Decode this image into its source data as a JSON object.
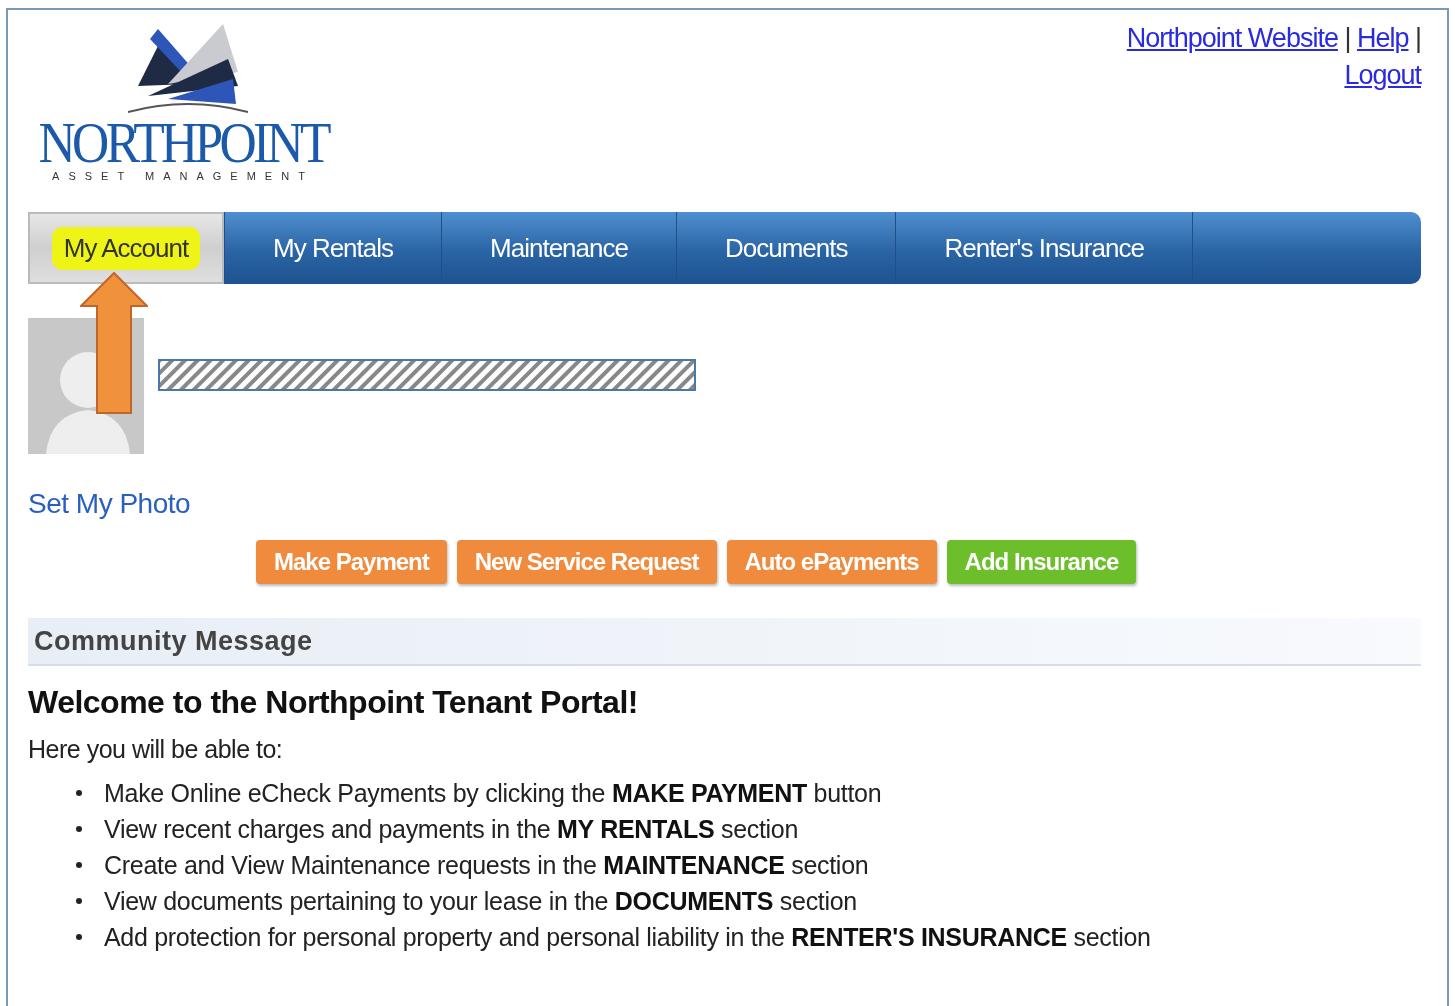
{
  "logo": {
    "name": "NORTHPOINT",
    "tagline": "ASSET MANAGEMENT"
  },
  "top_links": [
    {
      "label": "Northpoint Website",
      "separator": "|"
    },
    {
      "label": "Help",
      "separator": "|"
    },
    {
      "label": "Logout"
    }
  ],
  "tabs": [
    {
      "label": "My Account",
      "selected": true,
      "highlighted": true
    },
    {
      "label": "My Rentals",
      "selected": false,
      "highlighted": false
    },
    {
      "label": "Maintenance",
      "selected": false,
      "highlighted": false
    },
    {
      "label": "Documents",
      "selected": false,
      "highlighted": false
    },
    {
      "label": "Renter's Insurance",
      "selected": false,
      "highlighted": false
    }
  ],
  "profile": {
    "set_photo": "Set My Photo",
    "name_redacted": true
  },
  "actions": [
    {
      "label": "Make Payment",
      "color": "#f08a3c"
    },
    {
      "label": "New Service Request",
      "color": "#f08a3c"
    },
    {
      "label": "Auto ePayments",
      "color": "#f08a3c"
    },
    {
      "label": "Add Insurance",
      "color": "#6cbf2a"
    }
  ],
  "community": {
    "heading": "Community Message",
    "title": "Welcome to the Northpoint Tenant Portal!",
    "intro": "Here you will be able to:",
    "items": [
      "Make Online eCheck Payments by clicking the **MAKE PAYMENT** button",
      "View recent charges and payments in the **MY RENTALS** section",
      "Create and View Maintenance requests in the **MAINTENANCE** section",
      "View documents pertaining to your lease in the **DOCUMENTS** section",
      "Add protection for personal property and personal liability in the **RENTER'S INSURANCE** section"
    ]
  }
}
